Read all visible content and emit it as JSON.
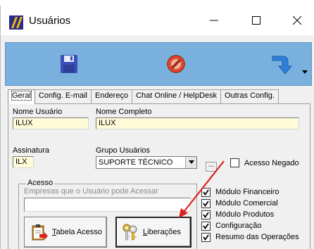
{
  "window": {
    "title": "Usuários",
    "controls": {
      "minimize": "—",
      "maximize": "☐",
      "close": "✕"
    }
  },
  "toolbar": {
    "buttons": [
      "save-icon",
      "cancel-icon",
      "navigate-icon"
    ]
  },
  "tabs": [
    "Geral",
    "Config. E-mail",
    "Endereço",
    "Chat Online / HelpDesk",
    "Outras Config."
  ],
  "form": {
    "nome_usuario_label": "Nome Usuário",
    "nome_usuario_value": "ILUX",
    "nome_completo_label": "Nome Completo",
    "nome_completo_value": "ILUX",
    "assinatura_label": "Assinatura",
    "assinatura_value": "ILX",
    "grupo_label": "Grupo Usuários",
    "grupo_value": "SUPORTE TÉCNICO",
    "ellipsis": "...",
    "acesso_negado_label": "Acesso Negado"
  },
  "acesso": {
    "title": "Acesso",
    "subtitle": "Empresas que o Usuário pode Acessar",
    "companies_value": ""
  },
  "buttons": {
    "tabela_first": "T",
    "tabela_rest": "abela Acesso",
    "lib_first": "L",
    "lib_rest": "iberações"
  },
  "modules": [
    {
      "label": "Módulo Financeiro",
      "checked": true
    },
    {
      "label": "Módulo Comercial",
      "checked": true
    },
    {
      "label": "Módulo Produtos",
      "checked": true
    },
    {
      "label": "Configuração",
      "checked": true
    },
    {
      "label": "Resumo das Operações",
      "checked": true
    }
  ],
  "colors": {
    "toolbar": "#7ab0dd",
    "required_field": "#fffbd8",
    "annotation_arrow": "#e02020"
  }
}
